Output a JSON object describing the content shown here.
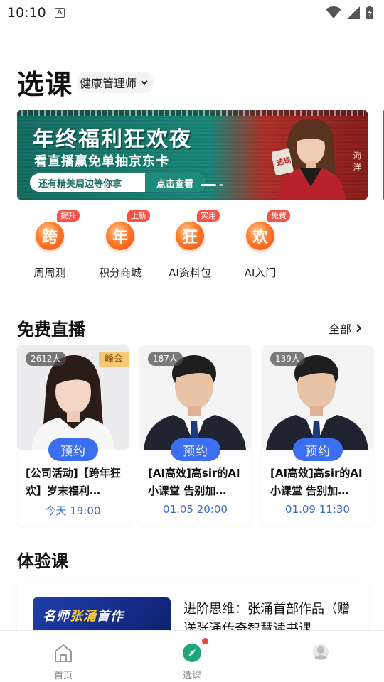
{
  "status_bar": {
    "time": "10:10",
    "app_icon": "A"
  },
  "header": {
    "title": "选课",
    "profession": "健康管理师"
  },
  "banner": {
    "title": "年终福利狂欢夜",
    "subtitle": "看直播赢免单抽京东卡",
    "pill_text": "还有精美周边等你拿",
    "pill_button": "点击查看",
    "person_name": "海洋",
    "sign_text": "选现"
  },
  "quick_entries": [
    {
      "badge": "提升",
      "glyph": "跨",
      "label": "周周测"
    },
    {
      "badge": "上新",
      "glyph": "年",
      "label": "积分商城"
    },
    {
      "badge": "实用",
      "glyph": "狂",
      "label": "AI资料包"
    },
    {
      "badge": "免费",
      "glyph": "欢",
      "label": "AI入门"
    }
  ],
  "live": {
    "title": "免费直播",
    "see_all": "全部",
    "cards": [
      {
        "viewers": "2612人",
        "tag": "峰会",
        "button": "预约",
        "title": "[公司活动]【跨年狂欢】岁末福利…",
        "time": "今天 19:00"
      },
      {
        "viewers": "187人",
        "tag": "",
        "button": "预约",
        "title": "[AI高效]高sir的AI小课堂 告别加…",
        "time": "01.05 20:00"
      },
      {
        "viewers": "139人",
        "tag": "",
        "button": "预约",
        "title": "[AI高效]高sir的AI小课堂 告别加…",
        "time": "01.09 11:30"
      }
    ]
  },
  "experience": {
    "title": "体验课",
    "thumb_text_prefix": "名师",
    "thumb_text_name": "张涌",
    "thumb_text_suffix": "首作",
    "course_title": "进阶思维：张涌首部作品（赠送张涌传奇智慧读书课"
  },
  "tabbar": {
    "tabs": [
      {
        "label": "首页",
        "icon": "home-icon"
      },
      {
        "label": "选课",
        "icon": "compass-icon"
      },
      {
        "label": "",
        "icon": "avatar-icon"
      }
    ]
  },
  "colors": {
    "accent_blue": "#3b6ef0",
    "time_blue": "#3a6cc7",
    "badge_red": "#f4534a",
    "orange": "#ff7a2a",
    "active_green": "#1fa77a"
  }
}
